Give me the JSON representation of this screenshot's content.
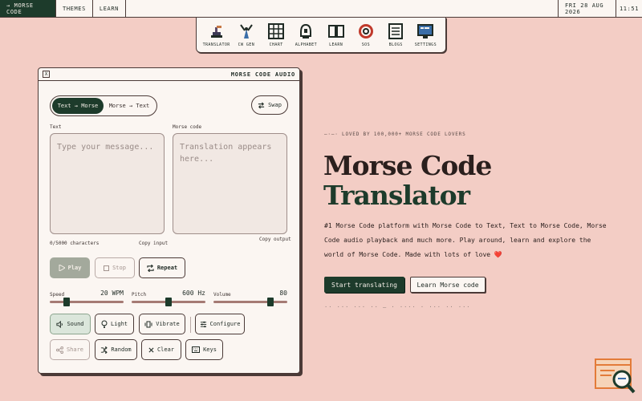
{
  "topbar": {
    "brand": "→ MORSE CODE",
    "themes": "THEMES",
    "learn": "LEARN",
    "date": "FRI 28 AUG 2026",
    "time": "11:51"
  },
  "nav": [
    {
      "label": "TRANSLATOR",
      "icon": "translator-icon"
    },
    {
      "label": "CW GEN",
      "icon": "antenna-icon"
    },
    {
      "label": "CHART",
      "icon": "chart-grid-icon"
    },
    {
      "label": "ALPHABET",
      "icon": "alphabet-icon"
    },
    {
      "label": "LEARN",
      "icon": "book-icon"
    },
    {
      "label": "SOS",
      "icon": "lifebuoy-icon"
    },
    {
      "label": "BLOGS",
      "icon": "document-icon"
    },
    {
      "label": "SETTINGS",
      "icon": "monitor-icon"
    }
  ],
  "panel": {
    "close": "X",
    "title": "MORSE CODE AUDIO",
    "mode_active": "Text → Morse",
    "mode_inactive": "Morse → Text",
    "swap": "Swap",
    "text_label": "Text",
    "morse_label": "Morse code",
    "text_placeholder": "Type your message...",
    "morse_placeholder": "Translation appears here...",
    "char_count": "0/5000 characters",
    "copy_input": "Copy input",
    "copy_output": "Copy output",
    "play": "Play",
    "stop": "Stop",
    "repeat": "Repeat",
    "speed_label": "Speed",
    "speed_value": "20 WPM",
    "speed_level": 0.2,
    "pitch_label": "Pitch",
    "pitch_value": "600 Hz",
    "pitch_level": 0.5,
    "volume_label": "Volume",
    "volume_value": "80",
    "volume_level": 0.8,
    "sound": "Sound",
    "light": "Light",
    "vibrate": "Vibrate",
    "configure": "Configure",
    "share": "Share",
    "random": "Random",
    "clear": "Clear",
    "keys": "Keys"
  },
  "hero": {
    "tagline": "—·—· LOVED BY 100,000+ MORSE CODE LOVERS",
    "title_line1": "Morse Code",
    "title_line2": "Translator",
    "description": "#1 Morse Code platform with Morse Code to Text, Text to Morse Code, Morse Code audio playback and much more. Play around, learn and explore the world of Morse Code. Made with lots of love ❤️",
    "cta_primary": "Start translating",
    "cta_secondary": "Learn Morse code",
    "morse_line": "·· ··· ··· ·· — · ···· · ··· ·· ···"
  },
  "colors": {
    "background": "#f3cdc5",
    "panel": "#fbf6f2",
    "accent": "#1d3b2b",
    "border": "#4b3a37"
  }
}
